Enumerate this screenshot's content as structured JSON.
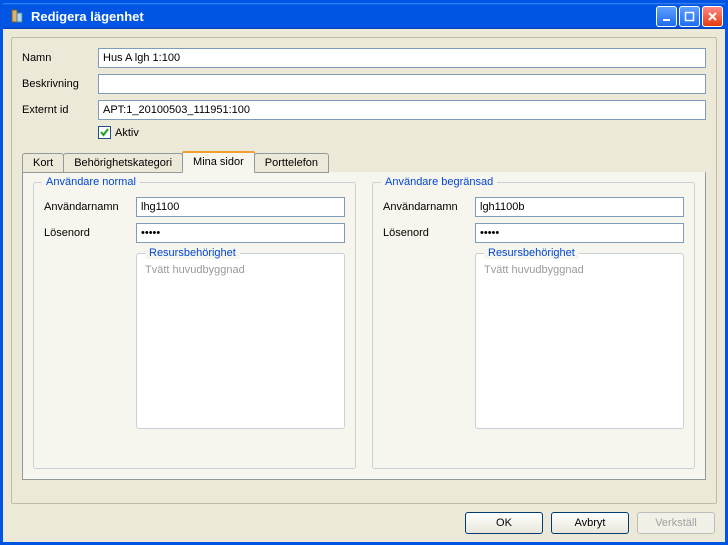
{
  "window": {
    "title": "Redigera lägenhet"
  },
  "form": {
    "labels": {
      "name": "Namn",
      "description": "Beskrivning",
      "external_id": "Externt id",
      "active": "Aktiv"
    },
    "values": {
      "name": "Hus A lgh 1:100",
      "description": "",
      "external_id": "APT:1_20100503_111951:100"
    },
    "active_checked": true
  },
  "tabs": [
    {
      "id": "kort",
      "label": "Kort",
      "active": false
    },
    {
      "id": "behorighet",
      "label": "Behörighetskategori",
      "active": false
    },
    {
      "id": "mina-sidor",
      "label": "Mina sidor",
      "active": true
    },
    {
      "id": "porttelefon",
      "label": "Porttelefon",
      "active": false
    }
  ],
  "panel": {
    "normal": {
      "legend": "Användare normal",
      "username_label": "Användarnamn",
      "username": "lhg1100",
      "password_label": "Lösenord",
      "password": "•••••",
      "resource_legend": "Resursbehörighet",
      "resources": [
        "Tvätt huvudbyggnad"
      ]
    },
    "limited": {
      "legend": "Användare begränsad",
      "username_label": "Användarnamn",
      "username": "lgh1100b",
      "password_label": "Lösenord",
      "password": "•••••",
      "resource_legend": "Resursbehörighet",
      "resources": [
        "Tvätt huvudbyggnad"
      ]
    }
  },
  "buttons": {
    "ok": "OK",
    "cancel": "Avbryt",
    "apply": "Verkställ"
  }
}
